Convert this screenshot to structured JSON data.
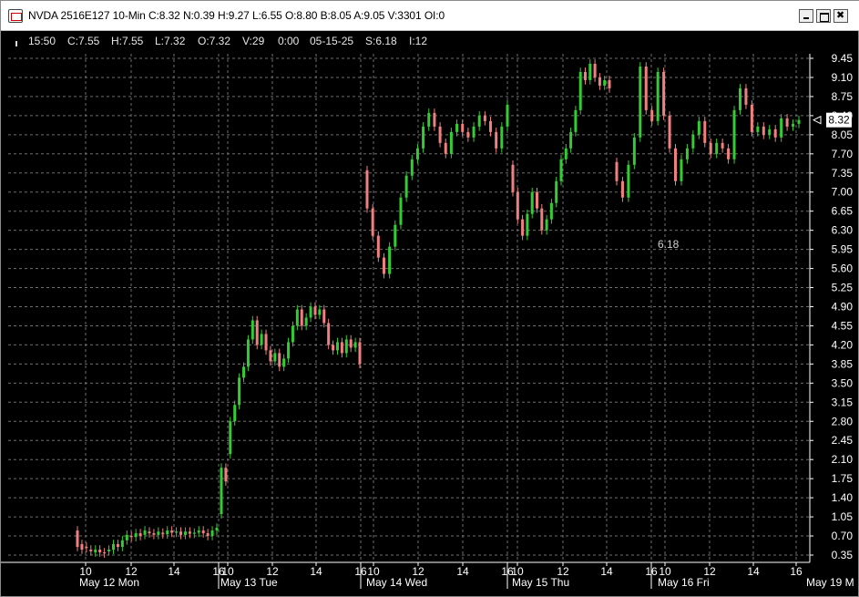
{
  "window": {
    "title": "NVDA 2516E127 10-Min C:8.32 N:0.39 H:9.27 L:6.55 O:8.80 B:8.05 A:9.05 V:3301 OI:0",
    "icon": "chart-window-icon",
    "controls": [
      "minimize-icon",
      "maximize-icon",
      "close-icon"
    ]
  },
  "infobar": {
    "time": "15:50",
    "close": "C:7.55",
    "high": "H:7.55",
    "low": "L:7.32",
    "open": "O:7.32",
    "volume": "V:29",
    "change": "0:00",
    "date": "05-15-25",
    "s_value": "S:6.18",
    "i_value": "I:12"
  },
  "colors": {
    "background": "#000000",
    "grid": "#6e6e6e",
    "up_candle": "#33cc33",
    "down_candle": "#f08080",
    "axis_text": "#ffffff",
    "last_price_box": "#ffffff"
  },
  "chart_data": {
    "type": "candlestick",
    "title": "",
    "xlabel": "",
    "ylabel": "",
    "ylim": [
      0.35,
      9.45
    ],
    "y_ticks": [
      "9.45",
      "9.10",
      "8.75",
      "8.40",
      "8.05",
      "7.70",
      "7.35",
      "7.00",
      "6.65",
      "6.30",
      "5.95",
      "5.60",
      "5.25",
      "4.90",
      "4.55",
      "4.20",
      "3.85",
      "3.50",
      "3.15",
      "2.80",
      "2.45",
      "2.10",
      "1.75",
      "1.40",
      "1.05",
      "0.70",
      "0.35"
    ],
    "x_tick_labels": [
      "10",
      "12",
      "14",
      "16",
      "10",
      "12",
      "14",
      "16",
      "10",
      "12",
      "14",
      "16",
      "10",
      "12",
      "14",
      "16",
      "10",
      "12",
      "14",
      "16"
    ],
    "date_labels": [
      "May 12 Mon",
      "May 13 Tue",
      "May 14 Wed",
      "May 15 Thu",
      "May 16 Fri",
      "May 19 M"
    ],
    "grid": true,
    "last_price": "8.32",
    "annotation": "6.18",
    "days": [
      {
        "date": "May 12",
        "points": [
          [
            0.8,
            0.5
          ],
          [
            0.55,
            0.45
          ],
          [
            0.5,
            0.48
          ],
          [
            0.45,
            0.42
          ],
          [
            0.4,
            0.45
          ],
          [
            0.45,
            0.4
          ],
          [
            0.4,
            0.38
          ],
          [
            0.42,
            0.45
          ],
          [
            0.45,
            0.55
          ],
          [
            0.55,
            0.5
          ],
          [
            0.5,
            0.62
          ],
          [
            0.62,
            0.72
          ],
          [
            0.7,
            0.68
          ],
          [
            0.68,
            0.75
          ],
          [
            0.75,
            0.7
          ],
          [
            0.72,
            0.8
          ],
          [
            0.78,
            0.75
          ],
          [
            0.75,
            0.72
          ],
          [
            0.72,
            0.78
          ],
          [
            0.76,
            0.73
          ],
          [
            0.73,
            0.8
          ],
          [
            0.8,
            0.76
          ],
          [
            0.76,
            0.78
          ],
          [
            0.78,
            0.72
          ],
          [
            0.72,
            0.78
          ],
          [
            0.78,
            0.74
          ],
          [
            0.74,
            0.76
          ],
          [
            0.76,
            0.8
          ],
          [
            0.8,
            0.75
          ],
          [
            0.75,
            0.7
          ],
          [
            0.7,
            0.8
          ],
          [
            0.8,
            0.85
          ]
        ]
      },
      {
        "date": "May 13",
        "points": [
          [
            1.1,
            1.95
          ],
          [
            1.95,
            1.7
          ],
          [
            2.2,
            2.8
          ],
          [
            2.8,
            3.1
          ],
          [
            3.1,
            3.6
          ],
          [
            3.6,
            3.8
          ],
          [
            3.8,
            4.3
          ],
          [
            4.3,
            4.65
          ],
          [
            4.65,
            4.2
          ],
          [
            4.2,
            4.4
          ],
          [
            4.4,
            4.1
          ],
          [
            4.1,
            3.9
          ],
          [
            3.9,
            4.05
          ],
          [
            4.05,
            3.8
          ],
          [
            3.8,
            3.95
          ],
          [
            3.95,
            4.25
          ],
          [
            4.25,
            4.55
          ],
          [
            4.55,
            4.85
          ],
          [
            4.85,
            4.55
          ],
          [
            4.55,
            4.7
          ],
          [
            4.7,
            4.9
          ],
          [
            4.9,
            4.75
          ],
          [
            4.75,
            4.85
          ],
          [
            4.85,
            4.6
          ],
          [
            4.6,
            4.2
          ],
          [
            4.2,
            4.1
          ],
          [
            4.1,
            4.25
          ],
          [
            4.25,
            4.05
          ],
          [
            4.05,
            4.3
          ],
          [
            4.3,
            4.15
          ],
          [
            4.15,
            4.25
          ],
          [
            4.25,
            3.85
          ]
        ]
      },
      {
        "date": "May 14",
        "points": [
          [
            7.4,
            6.7
          ],
          [
            6.7,
            6.2
          ],
          [
            6.2,
            5.8
          ],
          [
            5.8,
            5.5
          ],
          [
            5.5,
            6.0
          ],
          [
            6.0,
            6.4
          ],
          [
            6.4,
            6.9
          ],
          [
            6.9,
            7.3
          ],
          [
            7.3,
            7.6
          ],
          [
            7.6,
            7.8
          ],
          [
            7.8,
            8.2
          ],
          [
            8.2,
            8.45
          ],
          [
            8.45,
            8.2
          ],
          [
            8.2,
            7.9
          ],
          [
            7.9,
            7.7
          ],
          [
            7.7,
            8.1
          ],
          [
            8.1,
            8.25
          ],
          [
            8.25,
            8.1
          ],
          [
            8.1,
            8.0
          ],
          [
            8.0,
            8.2
          ],
          [
            8.2,
            8.4
          ],
          [
            8.4,
            8.3
          ],
          [
            8.3,
            8.1
          ],
          [
            8.1,
            7.8
          ],
          [
            7.8,
            8.2
          ],
          [
            8.2,
            8.6
          ]
        ]
      },
      {
        "date": "May 15",
        "points": [
          [
            7.5,
            7.0
          ],
          [
            7.0,
            6.5
          ],
          [
            6.5,
            6.2
          ],
          [
            6.2,
            6.6
          ],
          [
            6.6,
            7.0
          ],
          [
            7.0,
            6.7
          ],
          [
            6.7,
            6.3
          ],
          [
            6.3,
            6.5
          ],
          [
            6.5,
            6.8
          ],
          [
            6.8,
            7.2
          ],
          [
            7.2,
            7.6
          ],
          [
            7.6,
            7.8
          ],
          [
            7.8,
            8.1
          ],
          [
            8.1,
            8.5
          ],
          [
            8.5,
            9.2
          ],
          [
            9.2,
            9.05
          ],
          [
            9.05,
            9.35
          ],
          [
            9.35,
            9.1
          ],
          [
            9.1,
            8.95
          ],
          [
            8.95,
            9.05
          ],
          [
            9.05,
            8.9
          ]
        ]
      },
      {
        "date": "May 16",
        "points": [
          [
            7.55,
            7.2
          ],
          [
            7.2,
            6.9
          ],
          [
            6.9,
            7.5
          ],
          [
            7.5,
            8.0
          ],
          [
            8.0,
            9.3
          ],
          [
            9.3,
            8.5
          ],
          [
            8.5,
            8.3
          ],
          [
            8.3,
            9.2
          ],
          [
            9.2,
            8.4
          ],
          [
            8.4,
            7.8
          ],
          [
            7.8,
            7.2
          ],
          [
            7.2,
            7.6
          ],
          [
            7.6,
            7.8
          ],
          [
            7.8,
            8.05
          ],
          [
            8.05,
            8.3
          ],
          [
            8.3,
            7.9
          ],
          [
            7.9,
            7.7
          ],
          [
            7.7,
            7.9
          ],
          [
            7.9,
            7.8
          ],
          [
            7.8,
            7.6
          ],
          [
            7.6,
            8.5
          ],
          [
            8.5,
            8.9
          ],
          [
            8.9,
            8.6
          ],
          [
            8.6,
            8.1
          ],
          [
            8.1,
            8.2
          ],
          [
            8.2,
            8.05
          ],
          [
            8.05,
            8.15
          ],
          [
            8.15,
            8.0
          ],
          [
            8.0,
            8.35
          ],
          [
            8.35,
            8.2
          ],
          [
            8.2,
            8.25
          ],
          [
            8.25,
            8.32
          ]
        ]
      }
    ]
  }
}
